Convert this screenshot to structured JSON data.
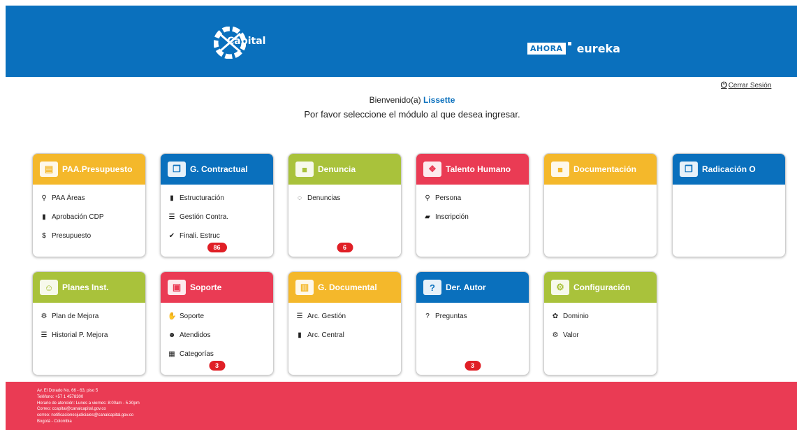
{
  "header": {
    "brand": "Capital",
    "ahora": "AHORA",
    "eureka": "eureka",
    "colors": {
      "header_bg": "#0a70bd",
      "footer_bg": "#ea3b54"
    }
  },
  "logout": {
    "label": "Cerrar Sesión",
    "icon": "power-icon"
  },
  "welcome": {
    "prefix": "Bienvenido(a)",
    "user": "Lissette",
    "instruction": "Por favor seleccione el módulo al que desea ingresar."
  },
  "modules": [
    {
      "title": "PAA.Presupuesto",
      "color": "#f4b82b",
      "icon": "monitor-chart-icon",
      "items": [
        {
          "label": "PAA Áreas",
          "icon": "sitemap-icon"
        },
        {
          "label": "Aprobación CDP",
          "icon": "file-icon"
        },
        {
          "label": "Presupuesto",
          "icon": "dollar-icon"
        }
      ],
      "badge": ""
    },
    {
      "title": "G. Contractual",
      "color": "#0a70bd",
      "icon": "documents-icon",
      "items": [
        {
          "label": "Estructuración",
          "icon": "file-icon"
        },
        {
          "label": "Gestión Contra.",
          "icon": "list-icon"
        },
        {
          "label": "Finali. Estruc",
          "icon": "check-icon"
        }
      ],
      "badge": "86"
    },
    {
      "title": "Denuncia",
      "color": "#a9c23b",
      "icon": "folder-icon",
      "items": [
        {
          "label": "Denuncias",
          "icon": "comment-icon"
        }
      ],
      "badge": "6"
    },
    {
      "title": "Talento Humano",
      "color": "#ea3b54",
      "icon": "network-icon",
      "items": [
        {
          "label": "Persona",
          "icon": "sitemap-icon"
        },
        {
          "label": "Inscripción",
          "icon": "book-icon"
        }
      ],
      "badge": ""
    },
    {
      "title": "Documentación",
      "color": "#f4b82b",
      "icon": "folder-icon",
      "items": [],
      "badge": ""
    },
    {
      "title": "Radicación O",
      "color": "#0a70bd",
      "icon": "documents-icon",
      "items": [],
      "badge": ""
    },
    {
      "title": "Planes Inst.",
      "color": "#a9c23b",
      "icon": "people-icon",
      "items": [
        {
          "label": "Plan de Mejora",
          "icon": "cogs-icon"
        },
        {
          "label": "Historial P. Mejora",
          "icon": "list-icon"
        }
      ],
      "badge": ""
    },
    {
      "title": "Soporte",
      "color": "#ea3b54",
      "icon": "support-icon",
      "items": [
        {
          "label": "Soporte",
          "icon": "handshake-icon"
        },
        {
          "label": "Atendidos",
          "icon": "user-check-icon"
        },
        {
          "label": "Categorías",
          "icon": "grid-icon"
        }
      ],
      "badge": "3"
    },
    {
      "title": "G. Documental",
      "color": "#f4b82b",
      "icon": "archive-icon",
      "items": [
        {
          "label": "Arc. Gestión",
          "icon": "list-icon"
        },
        {
          "label": "Arc. Central",
          "icon": "file-icon"
        }
      ],
      "badge": ""
    },
    {
      "title": "Der. Autor",
      "color": "#0a70bd",
      "icon": "question-bubble-icon",
      "items": [
        {
          "label": "Preguntas",
          "icon": "question-icon"
        }
      ],
      "badge": "3"
    },
    {
      "title": "Configuración",
      "color": "#a9c23b",
      "icon": "config-icon",
      "items": [
        {
          "label": "Dominio",
          "icon": "gear-icon"
        },
        {
          "label": "Valor",
          "icon": "cogs-icon"
        }
      ],
      "badge": ""
    }
  ],
  "footer": {
    "lines": [
      "Av. El Dorado No. 66 - 63, piso 5",
      "Teléfono: +57 1 4578300",
      "Horario de atención: Lunes a viernes: 8:00am - 5.30pm",
      "Correo: ccapital@canalcapital.gov.co",
      "correo: notificacionesjudiciales@canalcapital.gov.co",
      "Bogotá - Colombia"
    ]
  }
}
